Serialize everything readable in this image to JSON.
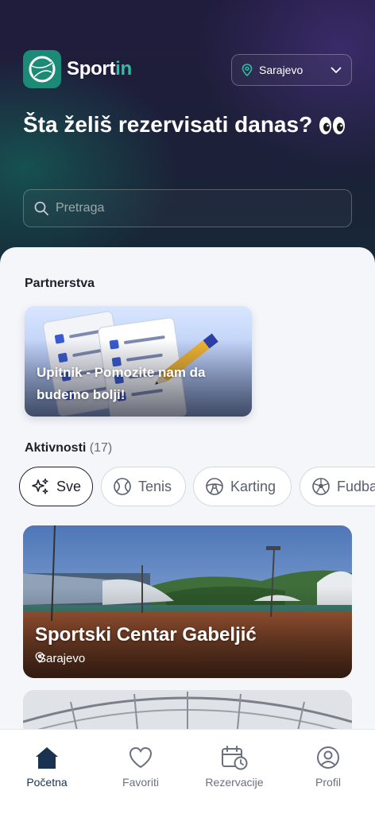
{
  "app": {
    "name_part1": "Sport",
    "name_part2": "in"
  },
  "location": {
    "selected": "Sarajevo"
  },
  "headline": {
    "text": "Šta želiš rezervisati danas?"
  },
  "search": {
    "placeholder": "Pretraga"
  },
  "partnerships": {
    "title": "Partnerstva",
    "cards": [
      {
        "title": "Upitnik - Pomozite nam da budemo bolji!"
      }
    ]
  },
  "activities": {
    "title": "Aktivnosti",
    "count": "(17)",
    "chips": [
      {
        "label": "Sve",
        "icon": "sparkles-icon",
        "active": true
      },
      {
        "label": "Tenis",
        "icon": "tennis-ball-icon",
        "active": false
      },
      {
        "label": "Karting",
        "icon": "steering-wheel-icon",
        "active": false
      },
      {
        "label": "Fudbal",
        "icon": "soccer-ball-icon",
        "active": false
      }
    ]
  },
  "venues": [
    {
      "name": "Sportski Centar Gabeljić",
      "location": "Sarajevo"
    },
    {
      "name": "",
      "location": ""
    }
  ],
  "bottom_nav": [
    {
      "label": "Početna",
      "icon": "home-icon",
      "active": true
    },
    {
      "label": "Favoriti",
      "icon": "heart-icon",
      "active": false
    },
    {
      "label": "Rezervacije",
      "icon": "calendar-clock-icon",
      "active": false
    },
    {
      "label": "Profil",
      "icon": "user-icon",
      "active": false
    }
  ],
  "colors": {
    "brand": "#1b8a76",
    "brand_accent": "#27c2a4",
    "hero_dark": "#201c3c",
    "nav_active": "#18324f"
  }
}
